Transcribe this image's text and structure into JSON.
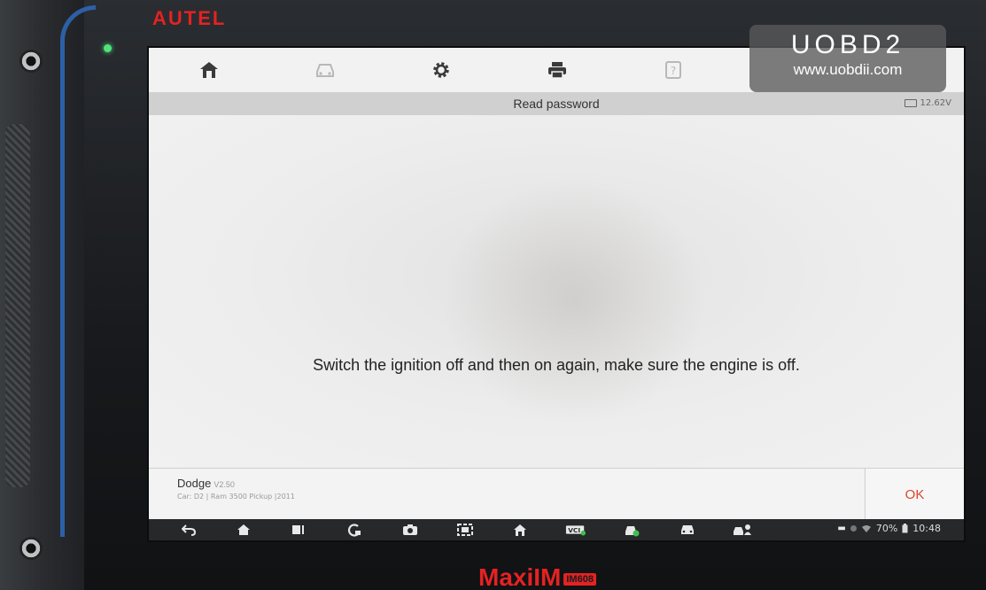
{
  "device": {
    "brand_top": "AUTEL",
    "brand_bottom": "MaxiIM",
    "model_badge": "IM608"
  },
  "watermark": {
    "title": "UOBD2",
    "url": "www.uobdii.com"
  },
  "toolbar": {
    "items": [
      {
        "icon": "home-icon",
        "enabled": true
      },
      {
        "icon": "vehicle-icon",
        "enabled": false
      },
      {
        "icon": "gear-icon",
        "enabled": true
      },
      {
        "icon": "printer-icon",
        "enabled": true
      },
      {
        "icon": "help-icon",
        "enabled": false
      }
    ]
  },
  "title_bar": {
    "title": "Read password",
    "voltage": "12.62V"
  },
  "main": {
    "message": "Switch the ignition off and then on again, make sure the engine is off."
  },
  "footer": {
    "vehicle_name": "Dodge",
    "vehicle_version": "V2.50",
    "vehicle_info": "Car: D2 | Ram 3500 Pickup |2011",
    "ok_label": "OK"
  },
  "navbar": {
    "items": [
      "back-icon",
      "home-icon",
      "recent-apps-icon",
      "refresh-icon",
      "camera-icon",
      "screenshot-icon",
      "maxi-home-icon",
      "vci-icon",
      "vehicle-check-icon",
      "car-icon",
      "car-person-icon"
    ],
    "battery": "70%",
    "time": "10:48"
  },
  "colors": {
    "accent_ok": "#d9462f",
    "brand_red": "#e42222",
    "led_green": "#4fe37a"
  }
}
